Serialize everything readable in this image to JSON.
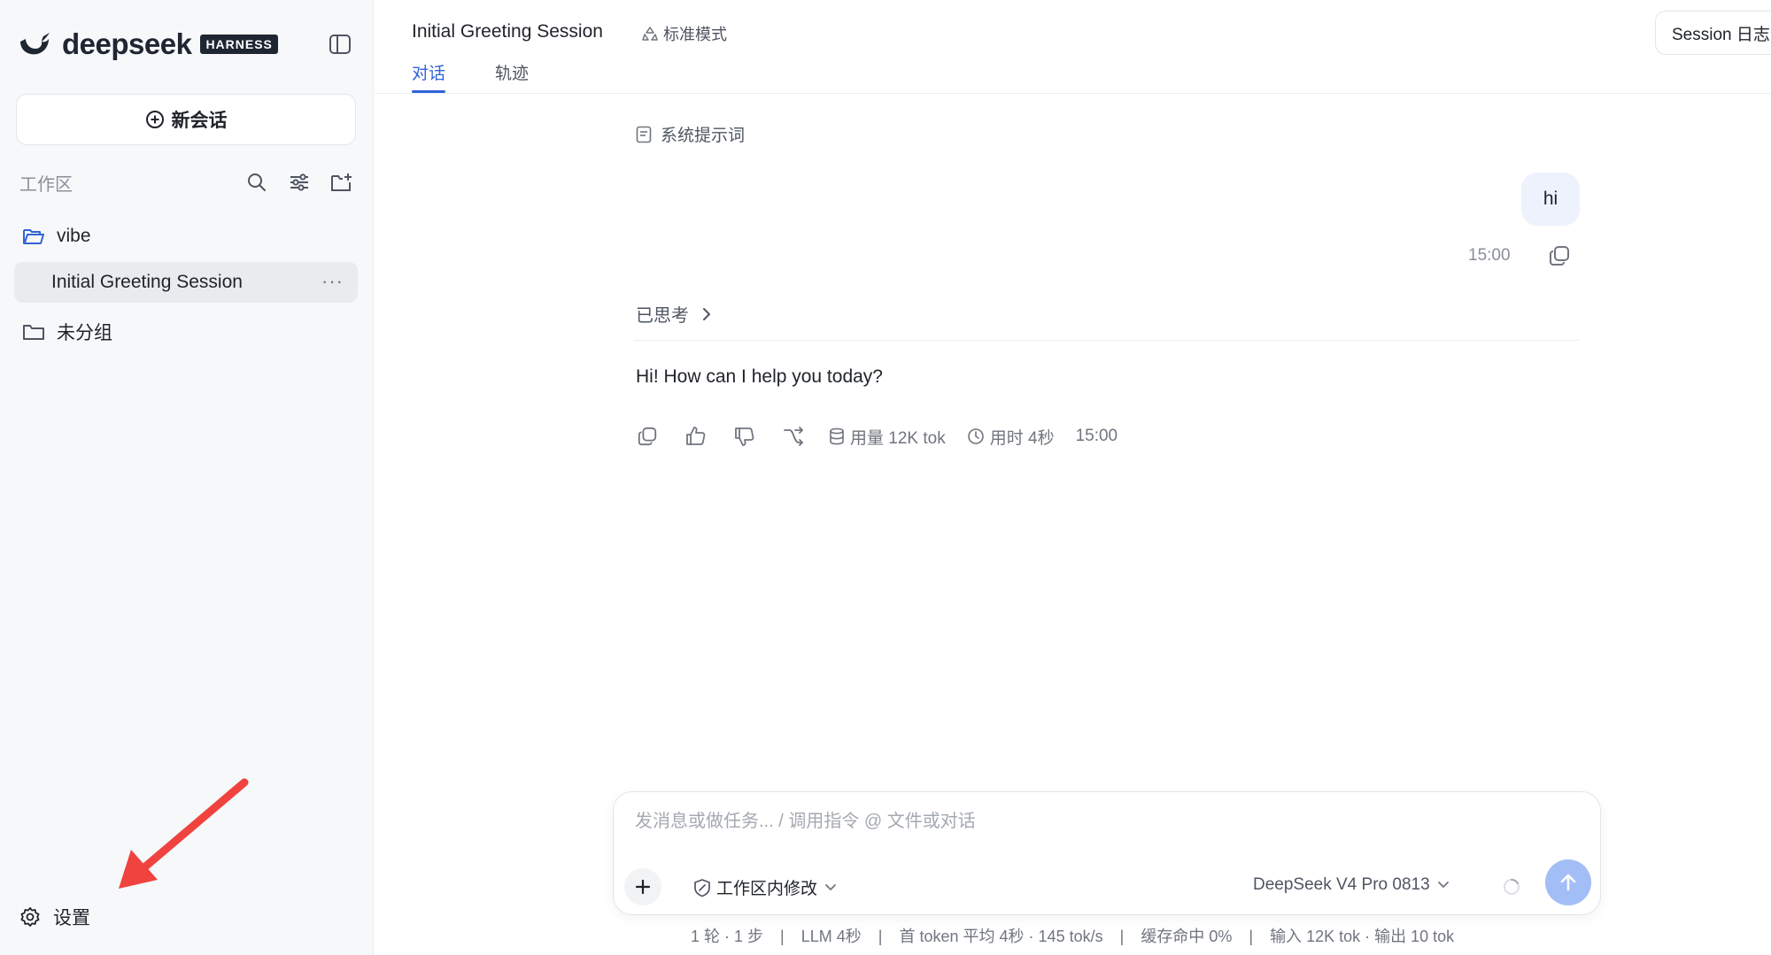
{
  "app": {
    "brand": "deepseek",
    "badge": "HARNESS"
  },
  "sidebar": {
    "new_chat_label": "新会话",
    "workspace_label": "工作区",
    "folders": [
      {
        "label": "vibe"
      },
      {
        "label": "未分组"
      }
    ],
    "active_session": {
      "label": "Initial Greeting Session",
      "more": "···"
    },
    "settings_label": "设置"
  },
  "header": {
    "title": "Initial Greeting Session",
    "mode": "标准模式",
    "tabs": [
      {
        "label": "对话",
        "active": true
      },
      {
        "label": "轨迹",
        "active": false
      }
    ],
    "session_log_button": "Session 日志"
  },
  "conversation": {
    "system_prompt_label": "系统提示词",
    "user_message": {
      "text": "hi",
      "time": "15:00"
    },
    "thought_label": "已思考",
    "assistant_message": {
      "text": "Hi! How can I help you today?",
      "usage": "用量 12K tok",
      "duration": "用时 4秒",
      "time": "15:00"
    }
  },
  "composer": {
    "placeholder": "发消息或做任务... / 调用指令 @ 文件或对话",
    "scope": "工作区内修改",
    "model": "DeepSeek V4 Pro 0813"
  },
  "stats": {
    "rounds": "1 轮 · 1 步",
    "llm": "LLM 4秒",
    "first_token": "首 token 平均 4秒 · 145 tok/s",
    "cache": "缓存命中 0%",
    "io": "输入 12K tok · 输出 10 tok"
  },
  "colors": {
    "accent": "#3164d8",
    "send_button": "#a3bdf6",
    "user_bubble": "#eef2fc",
    "annotation_arrow": "#f0433f"
  }
}
